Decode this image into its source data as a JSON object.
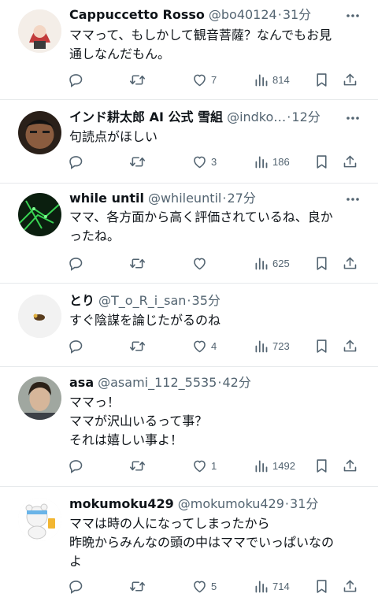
{
  "colors": {
    "text": "#0f1419",
    "secondary": "#536471",
    "divider": "#e6e9eb",
    "background": "#ffffff"
  },
  "icons": {
    "reply": "reply-icon",
    "retweet": "retweet-icon",
    "like": "heart-icon",
    "views": "views-icon",
    "bookmark": "bookmark-icon",
    "share": "share-icon",
    "more": "more-icon"
  },
  "tweets": [
    {
      "name": "Cappuccetto Rosso",
      "handle": "@bo40124",
      "sep": "·",
      "time": "31分",
      "text": "ママって、もしかして観音菩薩？なんでもお見\n通しなんだもん。",
      "likes": "7",
      "views": "814"
    },
    {
      "name": "インド耕太郎 AI 公式 雪組",
      "handle": "@indko…",
      "sep": "·",
      "time": "12分",
      "text": "句読点がほしい",
      "likes": "3",
      "views": "186"
    },
    {
      "name": "while until",
      "handle": "@whileuntil",
      "sep": "·",
      "time": "27分",
      "text": "ママ、各方面から高く評価されているね、良か\nったね。",
      "likes": "",
      "views": "625"
    },
    {
      "name": "とり",
      "handle": "@T_o_R_i_san",
      "sep": "·",
      "time": "35分",
      "text": "すぐ陰謀を論じたがるのね",
      "likes": "4",
      "views": "723"
    },
    {
      "name": "asa",
      "handle": "@asami_112_5535",
      "sep": "·",
      "time": "42分",
      "text": "ママっ！\nママが沢山いるって事？\nそれは嬉しい事よ！",
      "likes": "1",
      "views": "1492"
    },
    {
      "name": "mokumoku429",
      "handle": "@mokumoku429",
      "sep": "·",
      "time": "31分",
      "text": "ママは時の人になってしまったから\n昨晩からみんなの頭の中はママでいっぱいなの\nよ",
      "likes": "5",
      "views": "714"
    }
  ]
}
